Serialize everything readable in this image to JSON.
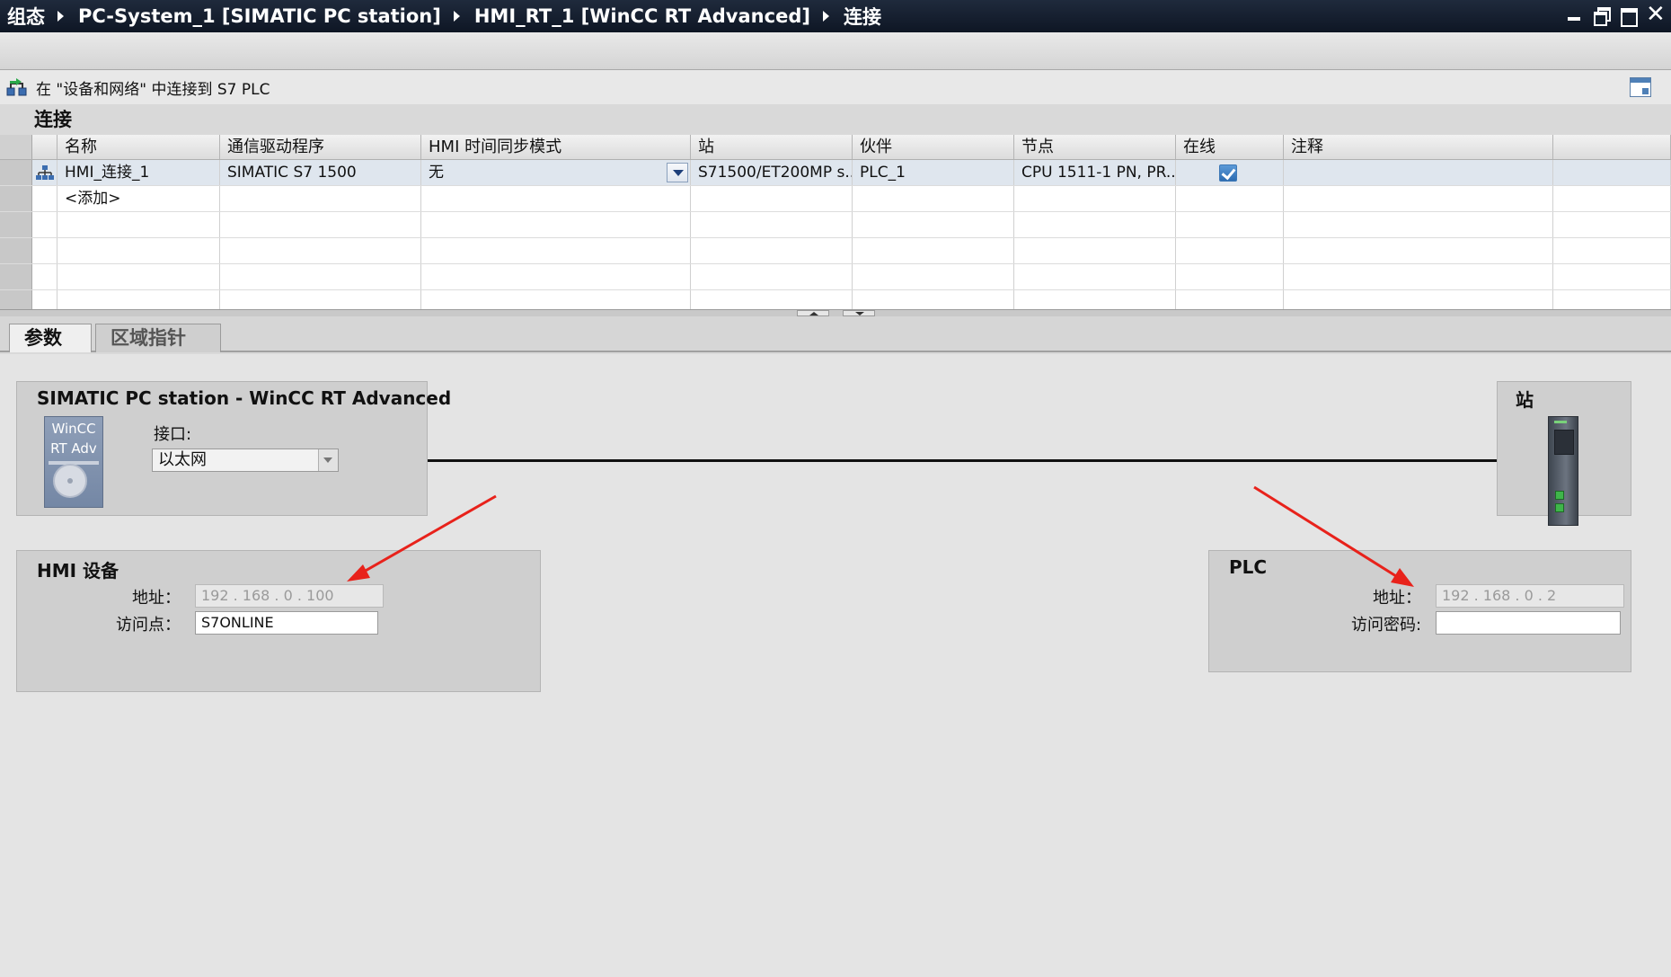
{
  "titlebar": {
    "breadcrumbs": [
      "组态",
      "PC-System_1 [SIMATIC PC station]",
      "HMI_RT_1 [WinCC RT Advanced]",
      "连接"
    ]
  },
  "infobar": {
    "text": "在 \"设备和网络\" 中连接到 S7 PLC",
    "icon": "connect-network-icon",
    "right_icon": "show-hide-panel-icon"
  },
  "section": {
    "title": "连接"
  },
  "table": {
    "columns": [
      "名称",
      "通信驱动程序",
      "HMI 时间同步模式",
      "站",
      "伙伴",
      "节点",
      "在线",
      "注释"
    ],
    "rows": [
      {
        "name": "HMI_连接_1",
        "driver": "SIMATIC S7 1500",
        "time_sync": "无",
        "station": "S71500/ET200MP s...",
        "partner": "PLC_1",
        "node": "CPU 1511-1 PN, PR...",
        "online": true,
        "comment": ""
      }
    ],
    "add_row": "<添加>"
  },
  "tabs": [
    {
      "label": "参数",
      "active": true
    },
    {
      "label": "区域指针",
      "active": false
    }
  ],
  "params": {
    "station_panel": {
      "title": "SIMATIC PC station - WinCC RT Advanced",
      "tile_line1": "WinCC",
      "tile_line2": "RT Adv",
      "interface_label": "接口:",
      "interface_value": "以太网"
    },
    "hmi_panel": {
      "title": "HMI 设备",
      "address_label": "地址：",
      "address_value": "192 . 168 . 0    . 100",
      "access_point_label": "访问点：",
      "access_point_value": "S7ONLINE"
    },
    "station_right": {
      "title": "站"
    },
    "plc_panel": {
      "title": "PLC",
      "address_label": "地址：",
      "address_value": "192 . 168 . 0    . 2",
      "password_label": "访问密码:",
      "password_value": ""
    }
  },
  "colors": {
    "titlebar_bg": "#141d2c",
    "selected_row": "#dfe6ee",
    "annotation_arrow": "#e8221b",
    "checkbox": "#2d6cb1"
  }
}
